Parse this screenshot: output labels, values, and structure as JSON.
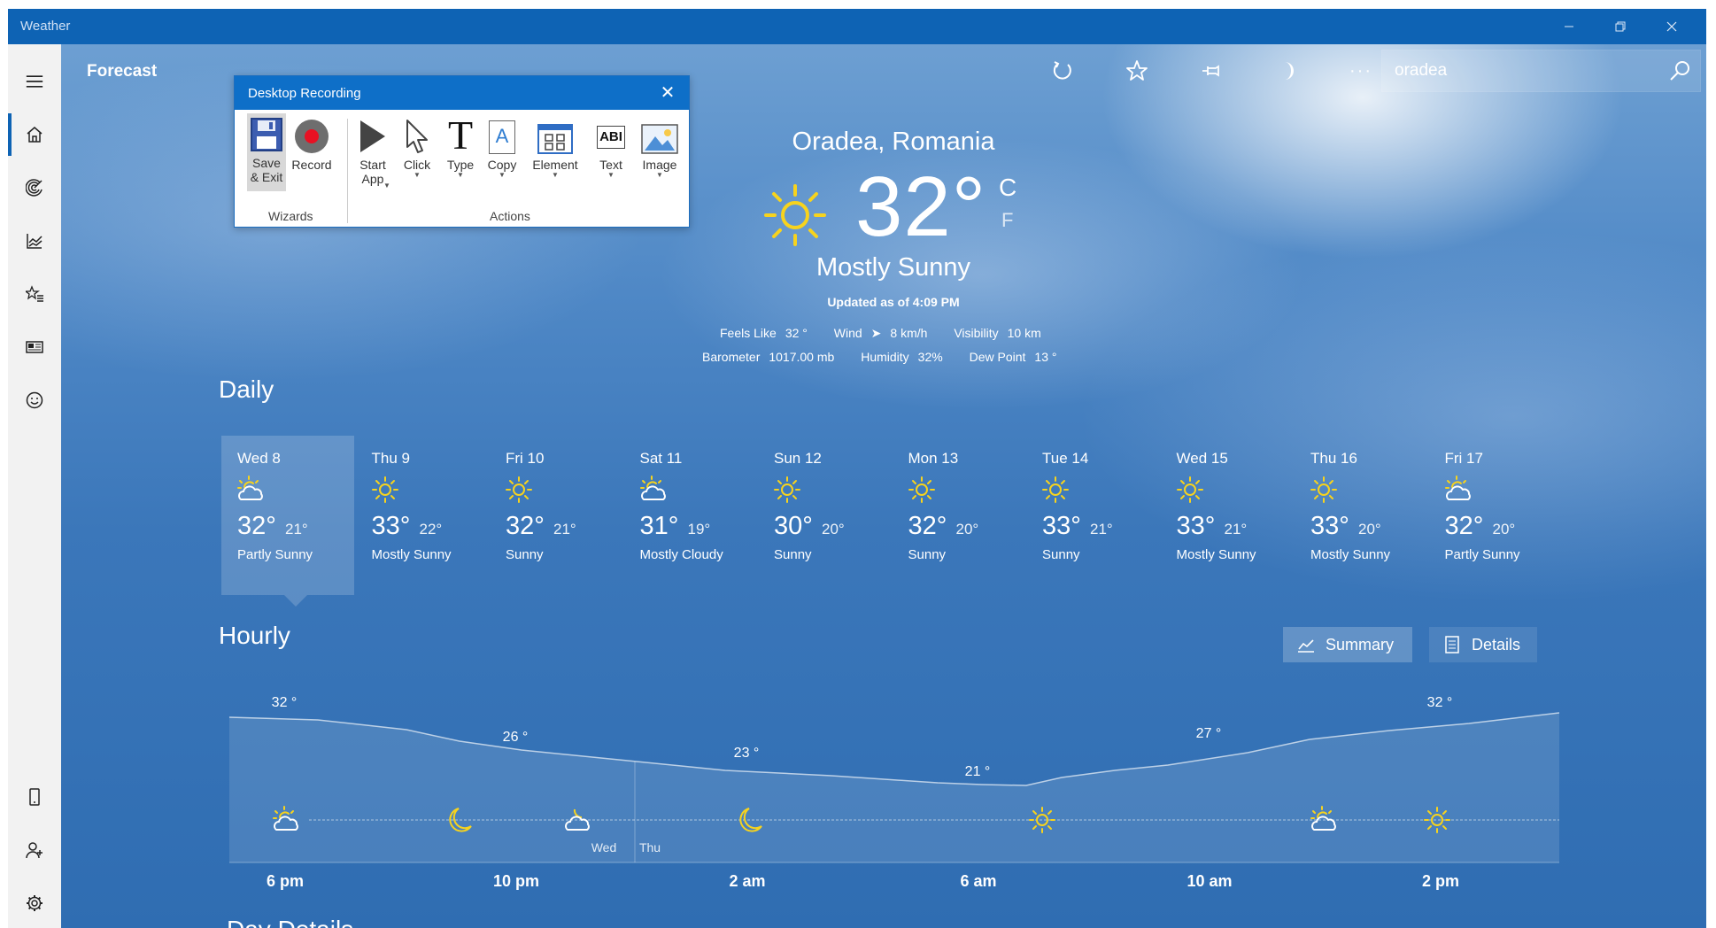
{
  "window": {
    "title": "Weather"
  },
  "appbar": {
    "page_title": "Forecast",
    "search_value": "oradea",
    "buttons": [
      "refresh-icon",
      "favorite-star-icon",
      "pin-icon",
      "theme-moon-icon",
      "more-icon"
    ],
    "more_label": "···"
  },
  "recording": {
    "title": "Desktop Recording",
    "close": "✕",
    "tools": [
      {
        "label": "Save\n& Exit",
        "icon": "save-icon"
      },
      {
        "label": "Record",
        "icon": "record-icon"
      },
      {
        "label": "Start\nApp",
        "icon": "play-icon"
      },
      {
        "label": "Click",
        "icon": "cursor-icon"
      },
      {
        "label": "Type",
        "icon": "type-icon"
      },
      {
        "label": "Copy",
        "icon": "copy-icon"
      },
      {
        "label": "Element",
        "icon": "element-icon"
      },
      {
        "label": "Text",
        "icon": "text-icon"
      },
      {
        "label": "Image",
        "icon": "image-icon"
      }
    ],
    "group_wizards": "Wizards",
    "group_actions": "Actions",
    "text_icon_glyph": "ABI",
    "type_icon_glyph": "T",
    "copy_icon_glyph": "A"
  },
  "current": {
    "location": "Oradea, Romania",
    "temp": "32°",
    "unit_c": "C",
    "unit_f": "F",
    "condition": "Mostly Sunny",
    "updated": "Updated as of 4:09 PM",
    "feels_like_label": "Feels Like",
    "feels_like": "32 °",
    "wind_label": "Wind",
    "wind_arrow": "➤",
    "wind": "8 km/h",
    "visibility_label": "Visibility",
    "visibility": "10 km",
    "barometer_label": "Barometer",
    "barometer": "1017.00 mb",
    "humidity_label": "Humidity",
    "humidity": "32%",
    "dewpoint_label": "Dew Point",
    "dewpoint": "13 °"
  },
  "daily": {
    "title": "Daily",
    "days": [
      {
        "name": "Wed 8",
        "hi": "32°",
        "lo": "21°",
        "cond": "Partly Sunny",
        "icon": "partly-sunny-icon"
      },
      {
        "name": "Thu 9",
        "hi": "33°",
        "lo": "22°",
        "cond": "Mostly Sunny",
        "icon": "sun-icon"
      },
      {
        "name": "Fri 10",
        "hi": "32°",
        "lo": "21°",
        "cond": "Sunny",
        "icon": "sun-icon"
      },
      {
        "name": "Sat 11",
        "hi": "31°",
        "lo": "19°",
        "cond": "Mostly Cloudy",
        "icon": "partly-sunny-icon"
      },
      {
        "name": "Sun 12",
        "hi": "30°",
        "lo": "20°",
        "cond": "Sunny",
        "icon": "sun-icon"
      },
      {
        "name": "Mon 13",
        "hi": "32°",
        "lo": "20°",
        "cond": "Sunny",
        "icon": "sun-icon"
      },
      {
        "name": "Tue 14",
        "hi": "33°",
        "lo": "21°",
        "cond": "Sunny",
        "icon": "sun-icon"
      },
      {
        "name": "Wed 15",
        "hi": "33°",
        "lo": "21°",
        "cond": "Mostly Sunny",
        "icon": "sun-icon"
      },
      {
        "name": "Thu 16",
        "hi": "33°",
        "lo": "20°",
        "cond": "Mostly Sunny",
        "icon": "sun-icon"
      },
      {
        "name": "Fri 17",
        "hi": "32°",
        "lo": "20°",
        "cond": "Partly Sunny",
        "icon": "partly-sunny-icon"
      }
    ]
  },
  "hourly": {
    "title": "Hourly",
    "summary_label": "Summary",
    "details_label": "Details",
    "temp_labels": [
      "32 °",
      "26 °",
      "23 °",
      "21 °",
      "27 °",
      "32 °"
    ],
    "icons": [
      "partly-sunny-icon",
      "moon-icon",
      "partly-cloudy-night-icon",
      "moon-icon",
      "sun-icon",
      "partly-sunny-icon",
      "sun-icon"
    ],
    "day_left": "Wed",
    "day_right": "Thu",
    "times": [
      "6 pm",
      "10 pm",
      "2 am",
      "6 am",
      "10 am",
      "2 pm"
    ]
  },
  "day_details": {
    "title": "Day Details"
  },
  "colors": {
    "accent": "#0e63b4",
    "sun": "#f7d31d",
    "sky": "#3b77ba"
  }
}
